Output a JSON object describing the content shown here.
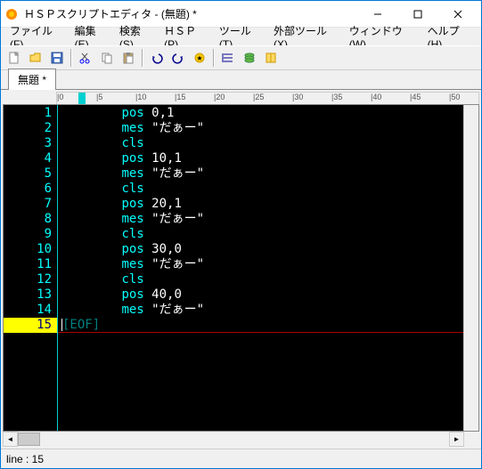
{
  "window": {
    "title": "ＨＳＰスクリプトエディタ - (無題) *"
  },
  "menu": {
    "file": "ファイル(F)",
    "edit": "編集(E)",
    "search": "検索(S)",
    "hsp": "ＨＳＰ(P)",
    "tool": "ツール(T)",
    "ext": "外部ツール(X)",
    "window": "ウィンドウ(W)",
    "help": "ヘルプ(H)"
  },
  "tab": {
    "label": "無題 *"
  },
  "ruler": {
    "marks": [
      "0",
      "5",
      "10",
      "15",
      "20",
      "25",
      "30",
      "35",
      "40",
      "45",
      "50"
    ]
  },
  "code": {
    "lines": [
      {
        "n": "1",
        "t": [
          [
            "kw",
            "pos"
          ],
          [
            "txt",
            " "
          ],
          [
            "num",
            "0,1"
          ]
        ]
      },
      {
        "n": "2",
        "t": [
          [
            "kw",
            "mes"
          ],
          [
            "txt",
            " "
          ],
          [
            "str",
            "\"だぁー\""
          ]
        ]
      },
      {
        "n": "3",
        "t": [
          [
            "kw",
            "cls"
          ]
        ]
      },
      {
        "n": "4",
        "t": [
          [
            "kw",
            "pos"
          ],
          [
            "txt",
            " "
          ],
          [
            "num",
            "10,1"
          ]
        ]
      },
      {
        "n": "5",
        "t": [
          [
            "kw",
            "mes"
          ],
          [
            "txt",
            " "
          ],
          [
            "str",
            "\"だぁー\""
          ]
        ]
      },
      {
        "n": "6",
        "t": [
          [
            "kw",
            "cls"
          ]
        ]
      },
      {
        "n": "7",
        "t": [
          [
            "kw",
            "pos"
          ],
          [
            "txt",
            " "
          ],
          [
            "num",
            "20,1"
          ]
        ]
      },
      {
        "n": "8",
        "t": [
          [
            "kw",
            "mes"
          ],
          [
            "txt",
            " "
          ],
          [
            "str",
            "\"だぁー\""
          ]
        ]
      },
      {
        "n": "9",
        "t": [
          [
            "kw",
            "cls"
          ]
        ]
      },
      {
        "n": "10",
        "t": [
          [
            "kw",
            "pos"
          ],
          [
            "txt",
            " "
          ],
          [
            "num",
            "30,0"
          ]
        ]
      },
      {
        "n": "11",
        "t": [
          [
            "kw",
            "mes"
          ],
          [
            "txt",
            " "
          ],
          [
            "str",
            "\"だぁー\""
          ]
        ]
      },
      {
        "n": "12",
        "t": [
          [
            "kw",
            "cls"
          ]
        ]
      },
      {
        "n": "13",
        "t": [
          [
            "kw",
            "pos"
          ],
          [
            "txt",
            " "
          ],
          [
            "num",
            "40,0"
          ]
        ]
      },
      {
        "n": "14",
        "t": [
          [
            "kw",
            "mes"
          ],
          [
            "txt",
            " "
          ],
          [
            "str",
            "\"だぁー\""
          ]
        ]
      },
      {
        "n": "15",
        "t": [
          [
            "eof",
            "[EOF]"
          ]
        ],
        "current": true
      }
    ],
    "indent": "\t"
  },
  "status": {
    "line": "line : 15"
  }
}
